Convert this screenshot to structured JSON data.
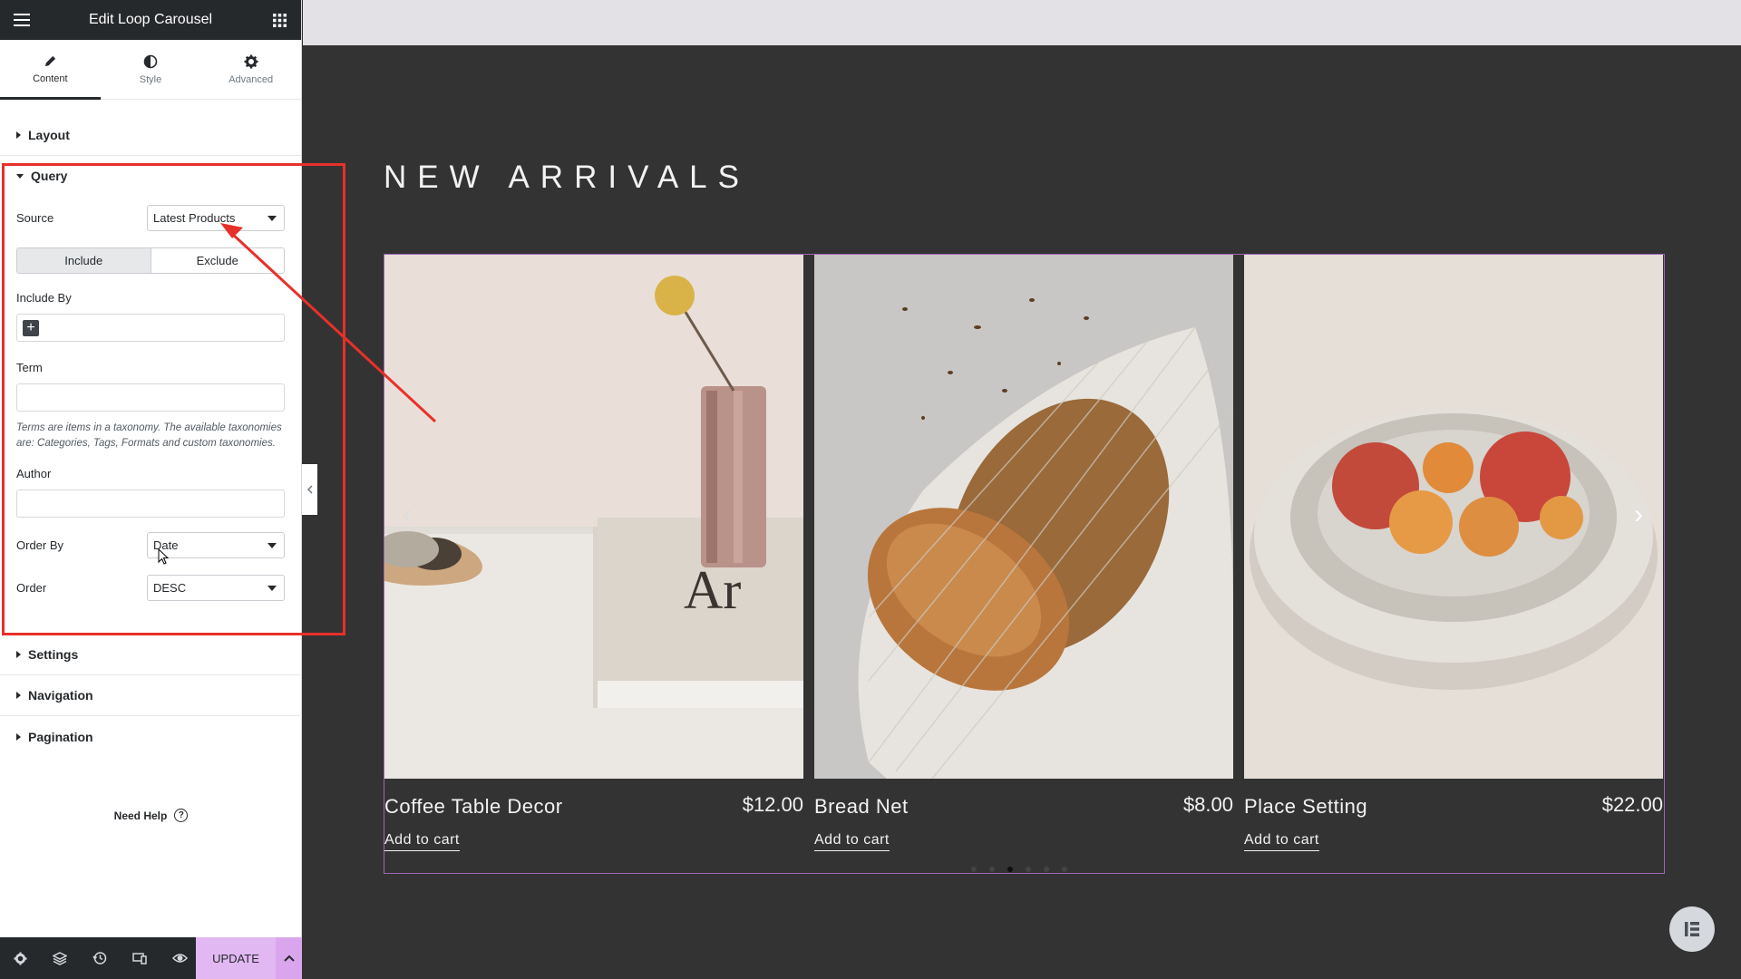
{
  "panel": {
    "title": "Edit Loop Carousel",
    "tabs": [
      {
        "label": "Content",
        "icon": "pencil-icon"
      },
      {
        "label": "Style",
        "icon": "half-circle-icon"
      },
      {
        "label": "Advanced",
        "icon": "gear-icon"
      }
    ],
    "sections": {
      "layout": "Layout",
      "query": "Query",
      "settings": "Settings",
      "navigation": "Navigation",
      "pagination": "Pagination"
    },
    "query": {
      "source_label": "Source",
      "source_value": "Latest Products",
      "include_label": "Include",
      "exclude_label": "Exclude",
      "include_by_label": "Include By",
      "term_label": "Term",
      "term_note": "Terms are items in a taxonomy. The available taxonomies are: Categories, Tags, Formats and custom taxonomies.",
      "author_label": "Author",
      "order_by_label": "Order By",
      "order_by_value": "Date",
      "order_label": "Order",
      "order_value": "DESC"
    },
    "need_help": "Need Help",
    "footer": {
      "update_label": "UPDATE"
    }
  },
  "preview": {
    "heading": "NEW ARRIVALS",
    "products": [
      {
        "name": "Coffee Table Decor",
        "price": "$12.00",
        "cart": "Add to cart"
      },
      {
        "name": "Bread Net",
        "price": "$8.00",
        "cart": "Add to cart"
      },
      {
        "name": "Place Setting",
        "price": "$22.00",
        "cart": "Add to cart"
      }
    ],
    "active_dot": 3,
    "dot_count": 6
  },
  "colors": {
    "accent": "#e1b8f2",
    "carousel_border": "#a066b4",
    "annotation_red": "#e8302a",
    "preview_bg": "#333333"
  }
}
